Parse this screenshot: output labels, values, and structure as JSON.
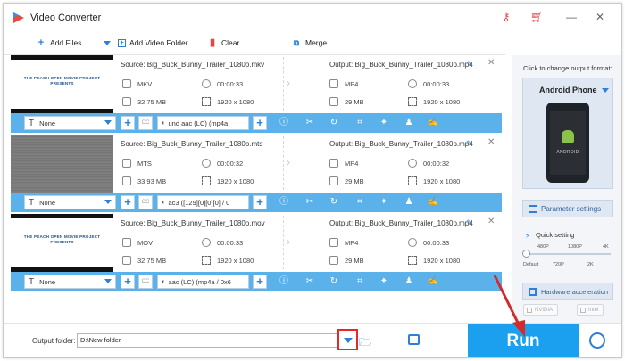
{
  "window": {
    "title": "Video Converter"
  },
  "toolbar": {
    "add_files": "Add Files",
    "add_video_folder": "Add Video Folder",
    "clear": "Clear",
    "merge": "Merge"
  },
  "items": [
    {
      "thumb_text": "THE PEACH OPEN MOVIE PROJECT PRESENTS",
      "source": "Source: Big_Buck_Bunny_Trailer_1080p.mkv",
      "src_format": "MKV",
      "src_duration": "00:00:33",
      "src_size": "32.75 MB",
      "src_res": "1920 x 1080",
      "output": "Output: Big_Buck_Bunny_Trailer_1080p.mp4",
      "out_format": "MP4",
      "out_duration": "00:00:33",
      "out_size": "29 MB",
      "out_res": "1920 x 1080",
      "subtitle": "None",
      "audio": "und aac (LC) (mp4a"
    },
    {
      "thumb_text": "",
      "source": "Source: Big_Buck_Bunny_Trailer_1080p.mts",
      "src_format": "MTS",
      "src_duration": "00:00:32",
      "src_size": "33.93 MB",
      "src_res": "1920 x 1080",
      "output": "Output: Big_Buck_Bunny_Trailer_1080p.mp4",
      "out_format": "MP4",
      "out_duration": "00:00:32",
      "out_size": "29 MB",
      "out_res": "1920 x 1080",
      "subtitle": "None",
      "audio": "ac3 ([129][0][0][0] / 0"
    },
    {
      "thumb_text": "THE PEACH OPEN MOVIE PROJECT PRESENTS",
      "source": "Source: Big_Buck_Bunny_Trailer_1080p.mov",
      "src_format": "MOV",
      "src_duration": "00:00:33",
      "src_size": "32.75 MB",
      "src_res": "1920 x 1080",
      "output": "Output: Big_Buck_Bunny_Trailer_1080p.mp4",
      "out_format": "MP4",
      "out_duration": "00:00:33",
      "out_size": "29 MB",
      "out_res": "1920 x 1080",
      "subtitle": "None",
      "audio": "aac (LC) (mp4a / 0x6"
    }
  ],
  "panel": {
    "hint": "Click to change output format:",
    "format": "Android Phone",
    "phone_brand": "ANDROID",
    "param_settings": "Parameter settings",
    "quick_setting": "Quick setting",
    "slider_top": [
      "480P",
      "1080P",
      "4K"
    ],
    "slider_bottom": [
      "Default",
      "720P",
      "2K"
    ],
    "hw_accel": "Hardware acceleration",
    "chip_nvidia": "NVIDIA",
    "chip_intel": "Intel"
  },
  "bottom": {
    "output_folder_label": "Output folder:",
    "output_folder_value": "D:\\New folder",
    "run": "Run"
  },
  "colors": {
    "accent": "#1aa0ee",
    "strip": "#5bb2ea",
    "highlight": "#e12a2a"
  }
}
